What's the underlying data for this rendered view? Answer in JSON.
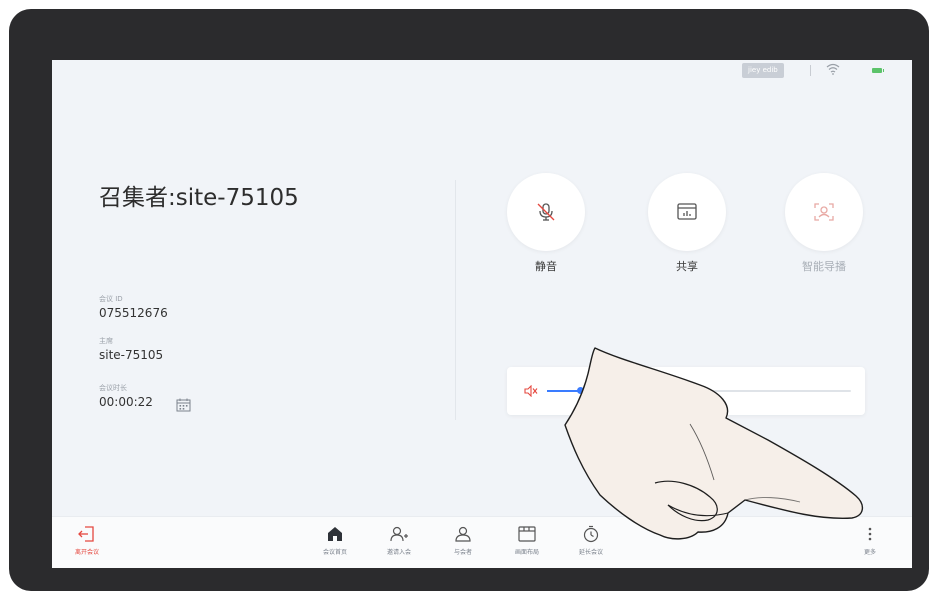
{
  "status_bar": {
    "tag": "jiey edib",
    "wifi_icon": "wifi-icon",
    "battery_icon": "battery-icon"
  },
  "meeting": {
    "title": "召集者:site-75105",
    "id_label": "会议 ID",
    "id_value": "075512676",
    "host_label": "主席",
    "host_value": "site-75105",
    "duration_label": "会议时长",
    "duration_value": "00:00:22"
  },
  "actions": [
    {
      "label": "静音",
      "icon": "mic-off-icon"
    },
    {
      "label": "共享",
      "icon": "share-screen-icon"
    },
    {
      "label": "智能导播",
      "icon": "smart-director-icon"
    }
  ],
  "volume": {
    "level": 0.11,
    "icon": "speaker-muted-icon"
  },
  "bottom_nav": {
    "leave": "离开会议",
    "home": "会议首页",
    "invite": "邀请入会",
    "participants": "与会者",
    "layout": "画面布局",
    "extend": "延长会议",
    "more": "更多"
  },
  "colors": {
    "accent": "#3a7cff",
    "leave": "#e5483f",
    "battery": "#5cc36a",
    "background": "#f1f4f8"
  }
}
